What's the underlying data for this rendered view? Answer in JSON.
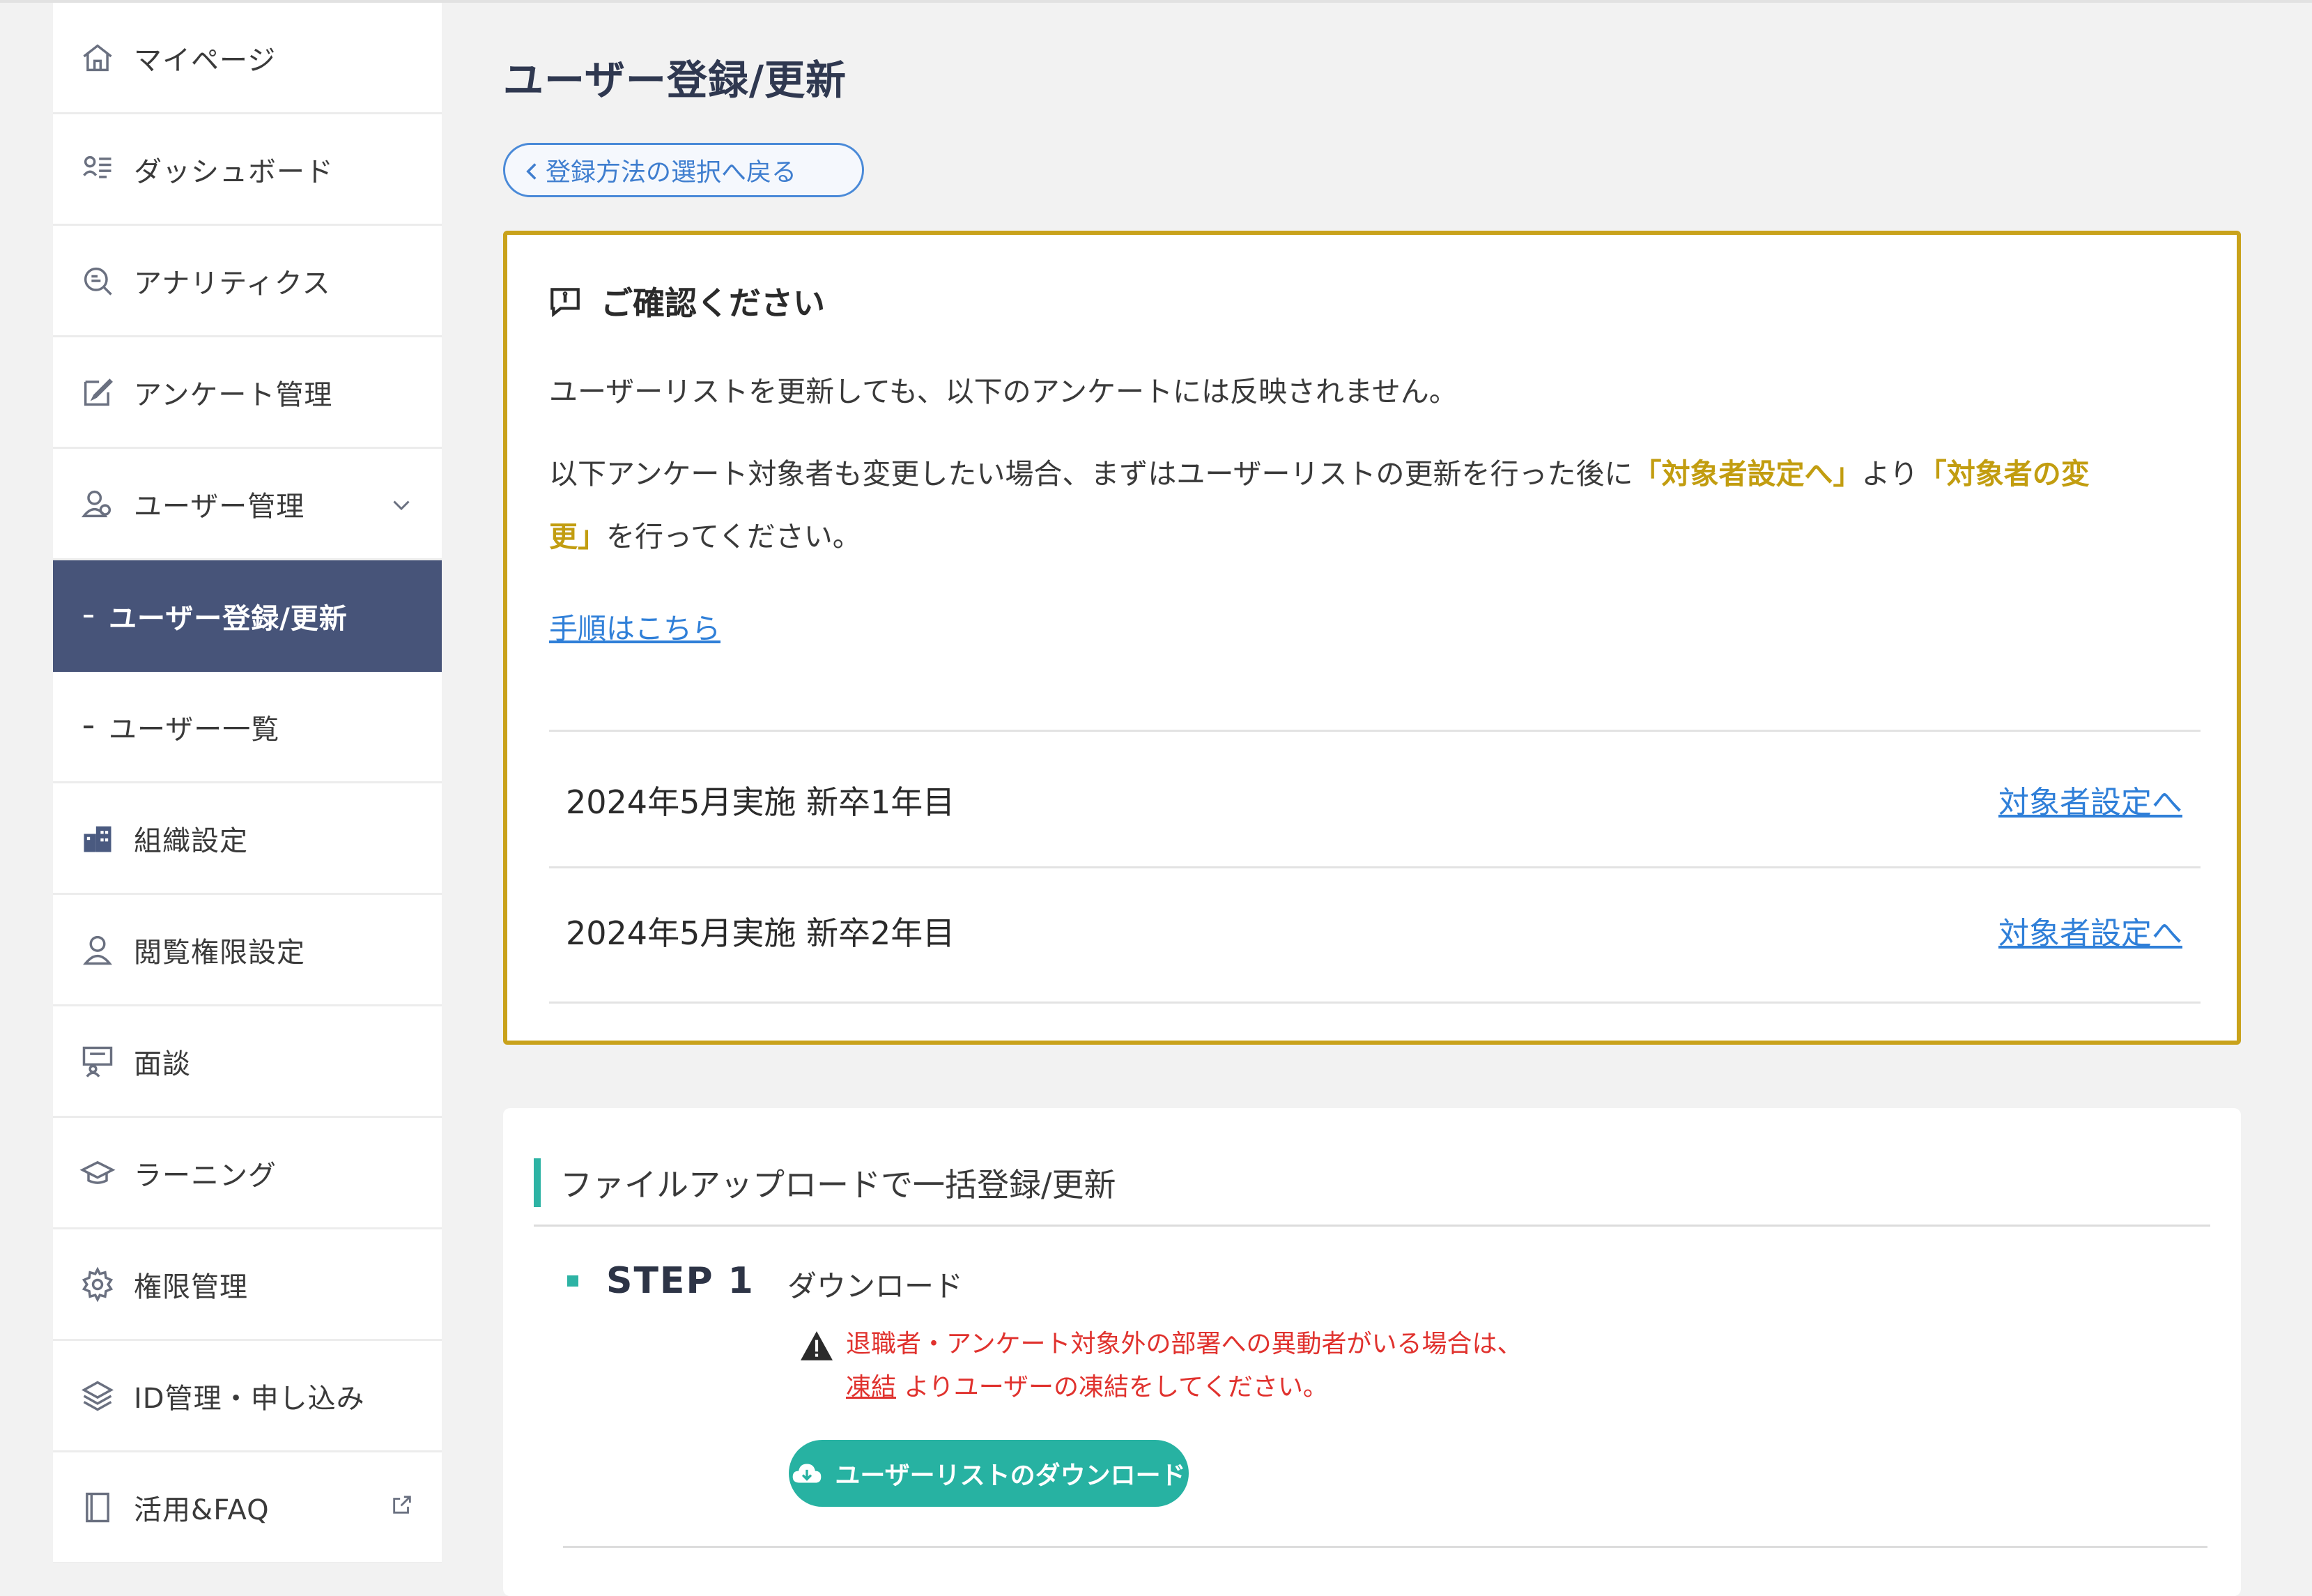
{
  "sidebar": {
    "items": [
      {
        "label": "マイページ",
        "icon": "home-icon"
      },
      {
        "label": "ダッシュボード",
        "icon": "dashboard-icon"
      },
      {
        "label": "アナリティクス",
        "icon": "analytics-icon"
      },
      {
        "label": "アンケート管理",
        "icon": "edit-icon"
      },
      {
        "label": "ユーザー管理",
        "icon": "users-icon"
      },
      {
        "label": "ユーザー登録/更新"
      },
      {
        "label": "ユーザー一覧"
      },
      {
        "label": "組織設定",
        "icon": "building-icon"
      },
      {
        "label": "閲覧権限設定",
        "icon": "user-icon"
      },
      {
        "label": "面談",
        "icon": "meeting-icon"
      },
      {
        "label": "ラーニング",
        "icon": "graduation-cap-icon"
      },
      {
        "label": "権限管理",
        "icon": "gear-icon"
      },
      {
        "label": "ID管理・申し込み",
        "icon": "layers-icon"
      },
      {
        "label": "活用&FAQ",
        "icon": "book-icon"
      }
    ],
    "active_color": "#475479"
  },
  "main": {
    "title": "ユーザー登録/更新",
    "back_label": "登録方法の選択へ戻る",
    "notice": {
      "heading": "ご確認ください",
      "line1": "ユーザーリストを更新しても、以下のアンケートには反映されません。",
      "line2_a": "以下アンケート対象者も変更したい場合、まずはユーザーリストの更新を行った後に",
      "line2_hl1": "「対象者設定へ」",
      "line2_b": "より",
      "line2_hl2a": "「対象者の変",
      "line2_hl2b": "更」",
      "line2_c": "を行ってください。",
      "procedure_link": "手順はこちら",
      "border_color": "#c9a21b",
      "surveys": [
        {
          "title": "2024年5月実施 新卒1年目",
          "link": "対象者設定へ"
        },
        {
          "title": "2024年5月実施 新卒2年目",
          "link": "対象者設定へ"
        }
      ]
    },
    "upload": {
      "heading": "ファイルアップロードで一括登録/更新",
      "step_label": "STEP 1",
      "step_name": "ダウンロード",
      "warning_line1": "退職者・アンケート対象外の部署への異動者がいる場合は、",
      "warning_link": "凍結",
      "warning_line2": "よりユーザーの凍結をしてください。",
      "download_button": "ユーザーリストのダウンロード",
      "accent_color": "#27b2a2"
    }
  }
}
